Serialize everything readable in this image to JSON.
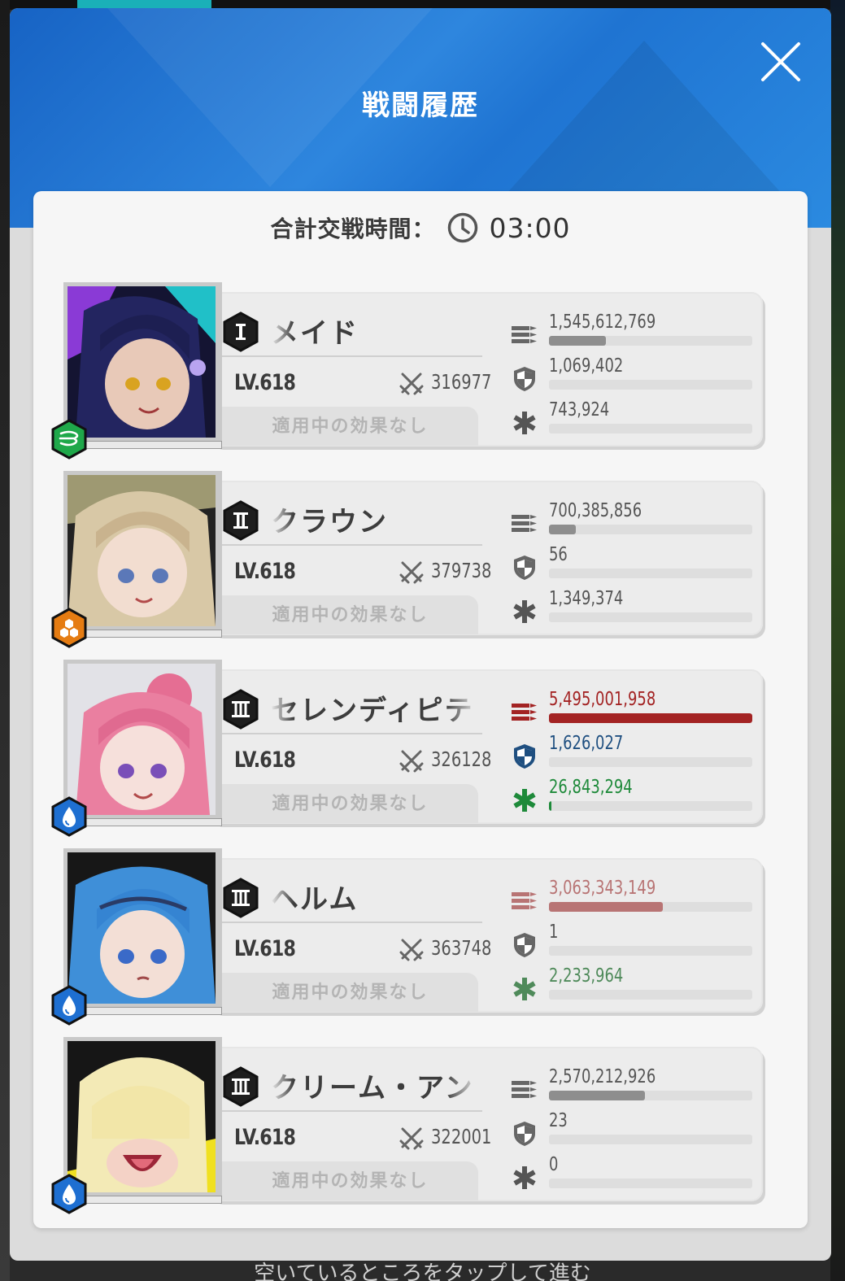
{
  "modal": {
    "title": "戦闘履歴",
    "total_label": "合計交戦時間：",
    "total_time": "03:00",
    "effect_text": "適用中の効果なし"
  },
  "characters": [
    {
      "burst": "I",
      "name": "メイド",
      "level": "LV.618",
      "power": "316977",
      "element": "wind",
      "element_color": "#1fa84a",
      "damage": "1,545,612,769",
      "damage_fraction": 0.28,
      "damage_taken": "1,069,402",
      "damage_taken_fraction": 0,
      "heal": "743,924",
      "heal_fraction": 0,
      "highlight": "none"
    },
    {
      "burst": "II",
      "name": "クラウン",
      "level": "LV.618",
      "power": "379738",
      "element": "iron",
      "element_color": "#e57c12",
      "damage": "700,385,856",
      "damage_fraction": 0.13,
      "damage_taken": "56",
      "damage_taken_fraction": 0,
      "heal": "1,349,374",
      "heal_fraction": 0,
      "highlight": "none"
    },
    {
      "burst": "III",
      "name": "セレンディピティ",
      "level": "LV.618",
      "power": "326128",
      "element": "water",
      "element_color": "#1e6fd1",
      "damage": "5,495,001,958",
      "damage_fraction": 1.0,
      "damage_taken": "1,626,027",
      "damage_taken_fraction": 0,
      "heal": "26,843,294",
      "heal_fraction": 0.01,
      "highlight": "max"
    },
    {
      "burst": "III",
      "name": "ヘルム",
      "level": "LV.618",
      "power": "363748",
      "element": "water",
      "element_color": "#1e6fd1",
      "damage": "3,063,343,149",
      "damage_fraction": 0.56,
      "damage_taken": "1",
      "damage_taken_fraction": 0,
      "heal": "2,233,964",
      "heal_fraction": 0,
      "highlight": "second"
    },
    {
      "burst": "III",
      "name": "クリーム・アンド・",
      "level": "LV.618",
      "power": "322001",
      "element": "water",
      "element_color": "#1e6fd1",
      "damage": "2,570,212,926",
      "damage_fraction": 0.47,
      "damage_taken": "23",
      "damage_taken_fraction": 0,
      "heal": "0",
      "heal_fraction": 0,
      "highlight": "none"
    }
  ],
  "colors": {
    "damage_max": "#a32323",
    "damage_second": "#b87474",
    "taken_max": "#1f4f80",
    "heal_max": "#1e8a3a",
    "heal_second": "#4f8a5a",
    "default_fill": "#8e8e8e",
    "default_text": "#555555"
  },
  "bottom_hint": "空いているところをタップして進む"
}
